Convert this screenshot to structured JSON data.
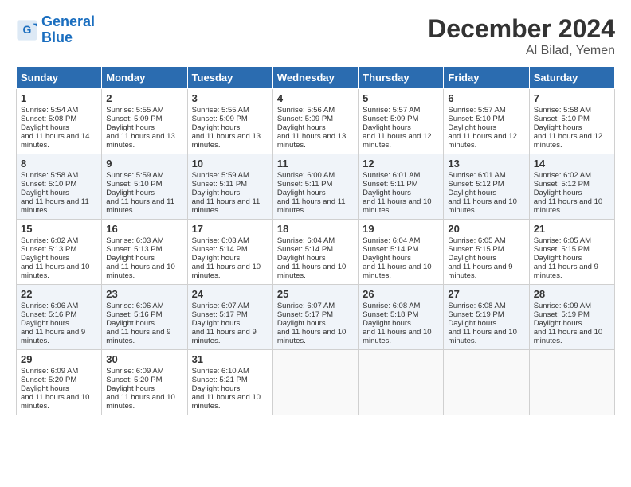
{
  "header": {
    "logo_line1": "General",
    "logo_line2": "Blue",
    "month": "December 2024",
    "location": "Al Bilad, Yemen"
  },
  "days_of_week": [
    "Sunday",
    "Monday",
    "Tuesday",
    "Wednesday",
    "Thursday",
    "Friday",
    "Saturday"
  ],
  "weeks": [
    [
      {
        "day": "1",
        "sunrise": "5:54 AM",
        "sunset": "5:08 PM",
        "daylight": "11 hours and 14 minutes."
      },
      {
        "day": "2",
        "sunrise": "5:55 AM",
        "sunset": "5:09 PM",
        "daylight": "11 hours and 13 minutes."
      },
      {
        "day": "3",
        "sunrise": "5:55 AM",
        "sunset": "5:09 PM",
        "daylight": "11 hours and 13 minutes."
      },
      {
        "day": "4",
        "sunrise": "5:56 AM",
        "sunset": "5:09 PM",
        "daylight": "11 hours and 13 minutes."
      },
      {
        "day": "5",
        "sunrise": "5:57 AM",
        "sunset": "5:09 PM",
        "daylight": "11 hours and 12 minutes."
      },
      {
        "day": "6",
        "sunrise": "5:57 AM",
        "sunset": "5:10 PM",
        "daylight": "11 hours and 12 minutes."
      },
      {
        "day": "7",
        "sunrise": "5:58 AM",
        "sunset": "5:10 PM",
        "daylight": "11 hours and 12 minutes."
      }
    ],
    [
      {
        "day": "8",
        "sunrise": "5:58 AM",
        "sunset": "5:10 PM",
        "daylight": "11 hours and 11 minutes."
      },
      {
        "day": "9",
        "sunrise": "5:59 AM",
        "sunset": "5:10 PM",
        "daylight": "11 hours and 11 minutes."
      },
      {
        "day": "10",
        "sunrise": "5:59 AM",
        "sunset": "5:11 PM",
        "daylight": "11 hours and 11 minutes."
      },
      {
        "day": "11",
        "sunrise": "6:00 AM",
        "sunset": "5:11 PM",
        "daylight": "11 hours and 11 minutes."
      },
      {
        "day": "12",
        "sunrise": "6:01 AM",
        "sunset": "5:11 PM",
        "daylight": "11 hours and 10 minutes."
      },
      {
        "day": "13",
        "sunrise": "6:01 AM",
        "sunset": "5:12 PM",
        "daylight": "11 hours and 10 minutes."
      },
      {
        "day": "14",
        "sunrise": "6:02 AM",
        "sunset": "5:12 PM",
        "daylight": "11 hours and 10 minutes."
      }
    ],
    [
      {
        "day": "15",
        "sunrise": "6:02 AM",
        "sunset": "5:13 PM",
        "daylight": "11 hours and 10 minutes."
      },
      {
        "day": "16",
        "sunrise": "6:03 AM",
        "sunset": "5:13 PM",
        "daylight": "11 hours and 10 minutes."
      },
      {
        "day": "17",
        "sunrise": "6:03 AM",
        "sunset": "5:14 PM",
        "daylight": "11 hours and 10 minutes."
      },
      {
        "day": "18",
        "sunrise": "6:04 AM",
        "sunset": "5:14 PM",
        "daylight": "11 hours and 10 minutes."
      },
      {
        "day": "19",
        "sunrise": "6:04 AM",
        "sunset": "5:14 PM",
        "daylight": "11 hours and 10 minutes."
      },
      {
        "day": "20",
        "sunrise": "6:05 AM",
        "sunset": "5:15 PM",
        "daylight": "11 hours and 9 minutes."
      },
      {
        "day": "21",
        "sunrise": "6:05 AM",
        "sunset": "5:15 PM",
        "daylight": "11 hours and 9 minutes."
      }
    ],
    [
      {
        "day": "22",
        "sunrise": "6:06 AM",
        "sunset": "5:16 PM",
        "daylight": "11 hours and 9 minutes."
      },
      {
        "day": "23",
        "sunrise": "6:06 AM",
        "sunset": "5:16 PM",
        "daylight": "11 hours and 9 minutes."
      },
      {
        "day": "24",
        "sunrise": "6:07 AM",
        "sunset": "5:17 PM",
        "daylight": "11 hours and 9 minutes."
      },
      {
        "day": "25",
        "sunrise": "6:07 AM",
        "sunset": "5:17 PM",
        "daylight": "11 hours and 10 minutes."
      },
      {
        "day": "26",
        "sunrise": "6:08 AM",
        "sunset": "5:18 PM",
        "daylight": "11 hours and 10 minutes."
      },
      {
        "day": "27",
        "sunrise": "6:08 AM",
        "sunset": "5:19 PM",
        "daylight": "11 hours and 10 minutes."
      },
      {
        "day": "28",
        "sunrise": "6:09 AM",
        "sunset": "5:19 PM",
        "daylight": "11 hours and 10 minutes."
      }
    ],
    [
      {
        "day": "29",
        "sunrise": "6:09 AM",
        "sunset": "5:20 PM",
        "daylight": "11 hours and 10 minutes."
      },
      {
        "day": "30",
        "sunrise": "6:09 AM",
        "sunset": "5:20 PM",
        "daylight": "11 hours and 10 minutes."
      },
      {
        "day": "31",
        "sunrise": "6:10 AM",
        "sunset": "5:21 PM",
        "daylight": "11 hours and 10 minutes."
      },
      null,
      null,
      null,
      null
    ]
  ]
}
